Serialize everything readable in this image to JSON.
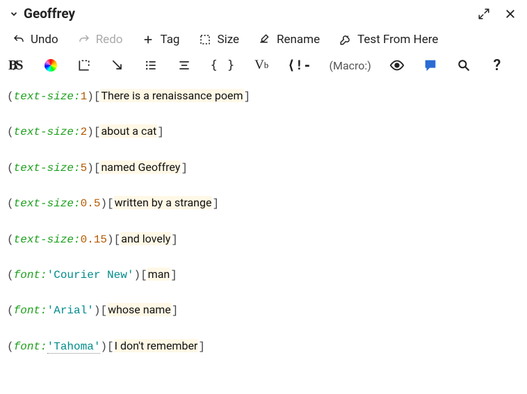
{
  "header": {
    "title": "Geoffrey"
  },
  "toolbar_a": {
    "undo": "Undo",
    "redo": "Redo",
    "tag": "Tag",
    "size": "Size",
    "rename": "Rename",
    "test": "Test From Here"
  },
  "toolbar_b": {
    "braces": "{ }",
    "macro_label": "(Macro:)",
    "question": "?"
  },
  "lines": [
    {
      "macro": "text-size",
      "arg": "1",
      "arg_type": "num",
      "hook": "There is a renaissance poem"
    },
    {
      "macro": "text-size",
      "arg": "2",
      "arg_type": "num",
      "hook": "about a cat"
    },
    {
      "macro": "text-size",
      "arg": "5",
      "arg_type": "num",
      "hook": "named Geoffrey"
    },
    {
      "macro": "text-size",
      "arg": "0.5",
      "arg_type": "num",
      "hook": "written by a strange"
    },
    {
      "macro": "text-size",
      "arg": "0.15",
      "arg_type": "num",
      "hook": "and lovely"
    },
    {
      "macro": "font",
      "arg": "'Courier New'",
      "arg_type": "str",
      "hook": "man"
    },
    {
      "macro": "font",
      "arg": "'Arial'",
      "arg_type": "str",
      "hook": "whose name"
    },
    {
      "macro": "font",
      "arg": "'Tahoma'",
      "arg_type": "str",
      "hook": "I don't remember",
      "underline_arg": true
    }
  ]
}
